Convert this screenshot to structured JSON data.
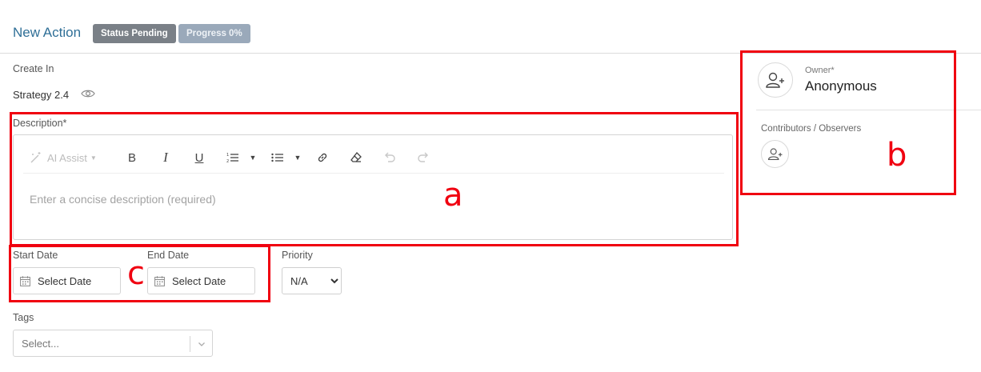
{
  "header": {
    "title": "New Action",
    "status_badge": "Status Pending",
    "progress_badge": "Progress 0%"
  },
  "create_in": {
    "label": "Create In",
    "value": "Strategy 2.4"
  },
  "description": {
    "label": "Description*",
    "placeholder": "Enter a concise description (required)",
    "toolbar": {
      "ai_assist": "AI Assist",
      "icons": [
        "magic-wand-icon",
        "bold-icon",
        "italic-icon",
        "underline-icon",
        "ordered-list-icon",
        "bullet-list-icon",
        "link-icon",
        "eraser-icon",
        "undo-icon",
        "redo-icon"
      ]
    }
  },
  "dates": {
    "start_label": "Start Date",
    "start_value": "Select Date",
    "end_label": "End Date",
    "end_value": "Select Date"
  },
  "priority": {
    "label": "Priority",
    "value": "N/A"
  },
  "tags": {
    "label": "Tags",
    "placeholder": "Select..."
  },
  "owner": {
    "label": "Owner*",
    "name": "Anonymous"
  },
  "contributors": {
    "label": "Contributors / Observers"
  },
  "annotations": {
    "a": "a",
    "b": "b",
    "c": "c",
    "color": "#f00010"
  },
  "colors": {
    "title": "#2f6f97",
    "status_badge": "#7a8087",
    "progress_badge": "#9aa9ba"
  }
}
